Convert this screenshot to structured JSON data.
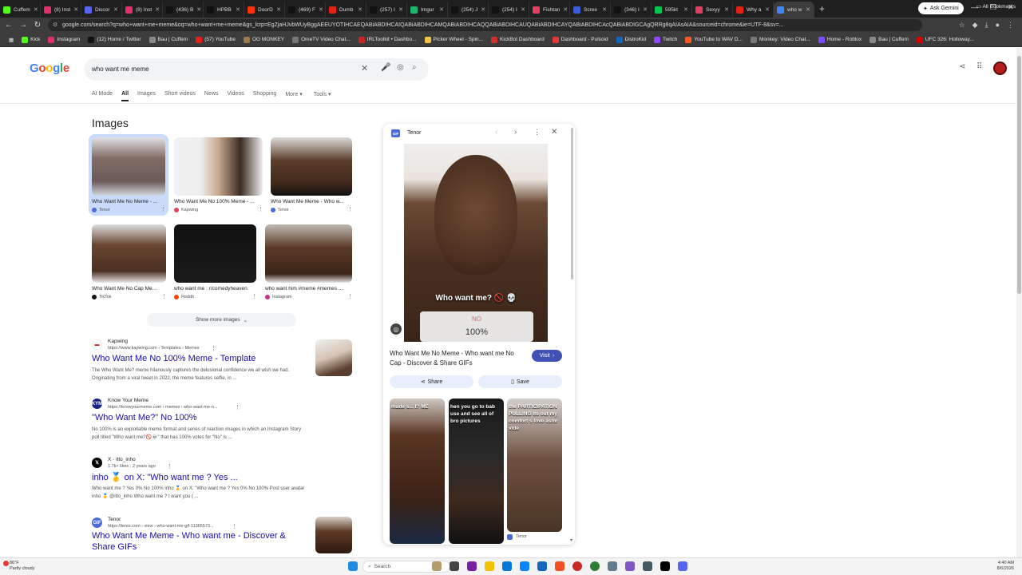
{
  "browser": {
    "tabs": [
      "Cuffem",
      "(8) Inst",
      "Discor",
      "(8) Inst",
      "(436) B",
      "HPBB",
      "DoorD",
      "(469) F",
      "Dumb",
      "(257) I",
      "Imgur",
      "(254) J",
      "(254) I",
      "Fishtan",
      "Scree",
      "(346) I",
      "595kt",
      "Sexyy",
      "Why a",
      "who w"
    ],
    "active_tab": "who w",
    "ask_gemini": "Ask Gemini",
    "url": "google.com/search?q=who+want+me+meme&oq=who+want+me+meme&gs_lcrp=EgZjaHJvbWUyBggAEEUYOTIHCAEQABiABDIHCAIQABiABDIHCAMQABiABDIHCAQQABiABDIHCAUQABiABDIHCAYQABiABDIHCAcQABiABDIGCAgQRRg8qAIAsAIA&sourceid=chrome&ie=UTF-8&sv=...",
    "bookmarks": [
      "Kick",
      "Instagram",
      "(12) Home / Twitter",
      "Bau | Cuffem",
      "(57) YouTube",
      "OG MONKEY",
      "OmeTV Video Chat...",
      "IRLToolkit • Dashbo...",
      "Picker Wheel - Spin...",
      "KickBot Dashboard",
      "Dashboard - Pulsoid",
      "DistroKid",
      "Twitch",
      "YouTube to WAV D...",
      "Monkey: Video Chat...",
      "Home - Roblox",
      "Bau | Cuffem",
      "UFC 326: Holloway..."
    ],
    "all_bookmarks": "All Bookmarks"
  },
  "google": {
    "logo": "Google",
    "query": "who want me meme",
    "tabs": [
      "AI Mode",
      "All",
      "Images",
      "Short videos",
      "News",
      "Videos",
      "Shopping",
      "More",
      "Tools"
    ],
    "active_tab": "All"
  },
  "images_section": {
    "heading": "Images",
    "items": [
      {
        "caption": "Who Want Me No Meme - ...",
        "source": "Tenor"
      },
      {
        "caption": "Who Want Me No 100% Meme - ...",
        "source": "Kapwing"
      },
      {
        "caption": "Who Want Me Meme - Who w...",
        "source": "Tenor"
      },
      {
        "caption": "Who Want Me No Cap Me...",
        "source": "TikTok"
      },
      {
        "caption": "who want me : r/comedyheaven",
        "source": "Reddit"
      },
      {
        "caption": "who want him #meme #memes ...",
        "source": "Instagram"
      }
    ],
    "show_more": "Show more images"
  },
  "results": [
    {
      "site": "Kapwing",
      "url": "https://www.kapwing.com › Templates › Memes",
      "title": "Who Want Me No 100% Meme - Template",
      "snippet": "The Who Want Me? meme hilariously captures the delusional confidence we all wish we had. Originating from a viral tweet in 2022, the meme features selfie, in ..."
    },
    {
      "site": "Know Your Meme",
      "url": "https://knowyourmeme.com › memes › who-want-me-n...",
      "title": "\"Who Want Me?\" No 100%",
      "snippet": "No 100% is an exploitable meme format and series of reaction images in which an Instagram Story poll titled \"Who want me?🚫💀\" that has 100% votes for \"No\" is ..."
    },
    {
      "site": "X · itto_inho",
      "url": "1.7k+ likes · 2 years ago",
      "title": "inho 🥇 on X: \"Who want me ? Yes ...",
      "snippet": "Who want me ? Yes 0% No 100% inho 🥇 on X: \"Who want me ? Yes 0% No 100% Post user avatar inho 🥇 @itto_inho Who want me ? I want you ( ..."
    },
    {
      "site": "Tenor",
      "url": "https://tenor.com › view › who-want-me-gif-11365573...",
      "title": "Who Want Me Meme - Who want me - Discover & Share GIFs",
      "snippet": ""
    }
  ],
  "panel": {
    "source": "Tenor",
    "gif_badge": "GIF",
    "overlay_text": "Who want me? 🚫 💀",
    "poll_no": "NO",
    "poll_pct": "100%",
    "title": "Who Want Me No Meme - Who want me No Cap - Discover & Share GIFs",
    "visit": "Visit",
    "share": "Share",
    "save": "Save",
    "related_texts": [
      "made s... I? ME",
      "hen you go to bab use and see all of bro pictures",
      "the PARTICIPATION PULLING its out my comfort s love asmr vide"
    ],
    "related_source": "Tenor"
  },
  "taskbar": {
    "temp": "86°F",
    "condition": "Partly cloudy",
    "search": "Search",
    "time": "4:40 AM",
    "date": "8/6/2026"
  },
  "colors": {
    "link": "#1a0dab",
    "tenor": "#4b6cd6",
    "visit_btn": "#3f51b5",
    "selected_tile": "#c9dafb"
  }
}
